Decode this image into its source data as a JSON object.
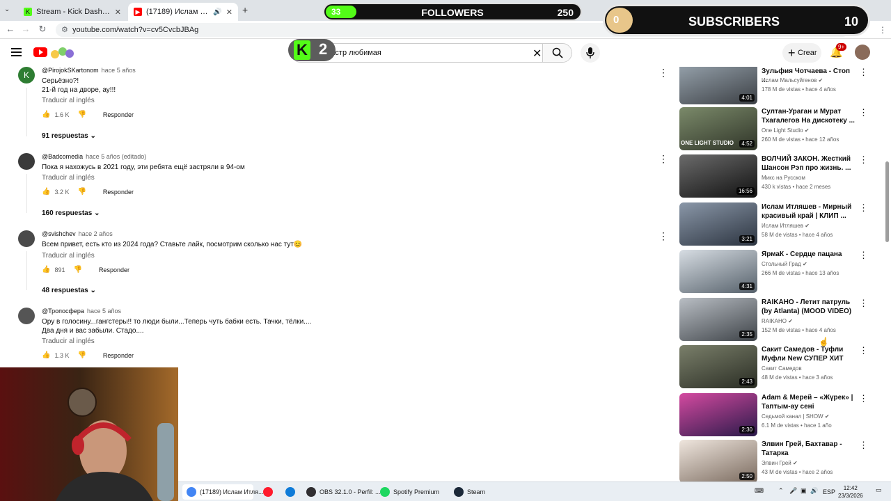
{
  "browser": {
    "tabs": [
      {
        "title": "Stream - Kick Dashboard"
      },
      {
        "title": "(17189) Ислам Итляшев, С"
      }
    ],
    "new_tab_glyph": "+",
    "url": "youtube.com/watch?v=cv5CvcbJBAg"
  },
  "overlay": {
    "followers": {
      "label": "FOLLOWERS",
      "current": "33",
      "goal": "250",
      "progress": 0.132
    },
    "subscribers": {
      "label": "SUBSCRIBERS",
      "current": "0",
      "goal": "10"
    },
    "kick_counter": "2"
  },
  "youtube": {
    "search_value": "хтастр любимая",
    "create_label": "Crear",
    "notif_count": "9+"
  },
  "comments": [
    {
      "avatar_letter": "K",
      "avatar_color": "#2e7d32",
      "author": "@PirojokSKartonom",
      "time": "hace 5 años",
      "text": "Серьёзно?!\n21-й год на дворе, ау!!!",
      "translate": "Traducir al inglés",
      "likes": "1.6 K",
      "reply": "Responder",
      "replies": "91 respuestas"
    },
    {
      "avatar_letter": "",
      "avatar_color": "#3a3a3a",
      "author": "@Badcomedia",
      "time": "hace 5 años (editado)",
      "text": "Пока я нахожусь в 2021 году, эти ребята ещё застряли в 94-ом",
      "translate": "Traducir al inglés",
      "likes": "3.2 K",
      "reply": "Responder",
      "replies": "160 respuestas"
    },
    {
      "avatar_letter": "",
      "avatar_color": "#4a4a4a",
      "author": "@svishchev",
      "time": "hace 2 años",
      "text": "Всем привет, есть кто из 2024 года? Ставьте лайк, посмотрим сколько нас тут😊",
      "translate": "Traducir al inglés",
      "likes": "891",
      "reply": "Responder",
      "replies": "48 respuestas"
    },
    {
      "avatar_letter": "",
      "avatar_color": "#555555",
      "author": "@Тропосфера",
      "time": "hace 5 años",
      "text": "Ору в голосину...гангстеры!! то люди были...Теперь чуть бабки есть. Тачки, тёлки....\nДва дня и вас забыли. Стадо....",
      "translate": "Traducir al inglés",
      "likes": "1.3 K",
      "reply": "Responder",
      "replies": ""
    }
  ],
  "sidebar": [
    {
      "title": "Зульфия Чотчаева - Стоп ...",
      "channel": "Ислам Мальсуйгенов",
      "verified": true,
      "views": "178 M de vistas",
      "age": "hace 4 años",
      "duration": "4:01",
      "caption": "",
      "c1": "#9aa6b0",
      "c2": "#3b3f44"
    },
    {
      "title": "Султан-Ураган и Мурат Тхагалегов На дискотеку ...",
      "channel": "One Light Studio",
      "verified": true,
      "views": "260 M de vistas",
      "age": "hace 12 años",
      "duration": "4:52",
      "caption": "ONE LIGHT STUDIO",
      "c1": "#7b8a6a",
      "c2": "#2f3428"
    },
    {
      "title": "ВОЛЧИЙ ЗАКОН. Жесткий Шансон Рэп про жизнь. ...",
      "channel": "Микс на Русском",
      "verified": false,
      "views": "430 k vistas",
      "age": "hace 2 meses",
      "duration": "16:56",
      "caption": "",
      "c1": "#6b6b6b",
      "c2": "#111111"
    },
    {
      "title": "Ислам Итляшев - Мирный красивый край | КЛИП ...",
      "channel": "Ислам Итляшев",
      "verified": true,
      "views": "58 M de vistas",
      "age": "hace 4 años",
      "duration": "3:21",
      "caption": "",
      "c1": "#8a97a8",
      "c2": "#2c3440"
    },
    {
      "title": "ЯрмаК - Сердце пацана",
      "channel": "Стольный Град",
      "verified": true,
      "views": "266 M de vistas",
      "age": "hace 13 años",
      "duration": "4:31",
      "caption": "",
      "c1": "#d7dde3",
      "c2": "#56616b"
    },
    {
      "title": "RAIKAHO - Летит патруль (by Atlanta) (MOOD VIDEO)",
      "channel": "RAIKAHO",
      "verified": true,
      "views": "152 M de vistas",
      "age": "hace 4 años",
      "duration": "2:35",
      "caption": "",
      "c1": "#b9bec4",
      "c2": "#3e4348"
    },
    {
      "title": "Сакит Самедов - Туфли Муфли New СУПЕР ХИТ  Шах...",
      "channel": "Сакит Самедов",
      "verified": false,
      "views": "48 M de vistas",
      "age": "hace 3 años",
      "duration": "2:43",
      "caption": "",
      "c1": "#7a7f6a",
      "c2": "#2a2d24"
    },
    {
      "title": "Adam & Мерей – «Жүрек» |  Таптым-ау сені",
      "channel": "Седьмой канал | SHOW",
      "verified": true,
      "views": "6.1 M de vistas",
      "age": "hace 1 año",
      "duration": "2:30",
      "caption": "",
      "c1": "#d44aa0",
      "c2": "#2a1a4a"
    },
    {
      "title": "Элвин Грей, Бахтавар - Татарка",
      "channel": "Элвин Грей",
      "verified": true,
      "views": "43 M de vistas",
      "age": "hace 2 años",
      "duration": "2:50",
      "caption": "",
      "c1": "#efe6de",
      "c2": "#7a6a5e"
    }
  ],
  "taskbar": {
    "tasks": [
      {
        "label": "(17189) Ислам Итля...",
        "color": "#4285f4"
      },
      {
        "label": "",
        "color": "#ff1b2d"
      },
      {
        "label": "",
        "color": "#0f7bd8"
      },
      {
        "label": "OBS 32.1.0 - Perfil: ...",
        "color": "#302e31"
      },
      {
        "label": "Spotify Premium",
        "color": "#1ed760"
      },
      {
        "label": "Steam",
        "color": "#1b2838"
      }
    ],
    "lang": "ESP",
    "time": "12:42",
    "date": "23/3/2026"
  }
}
